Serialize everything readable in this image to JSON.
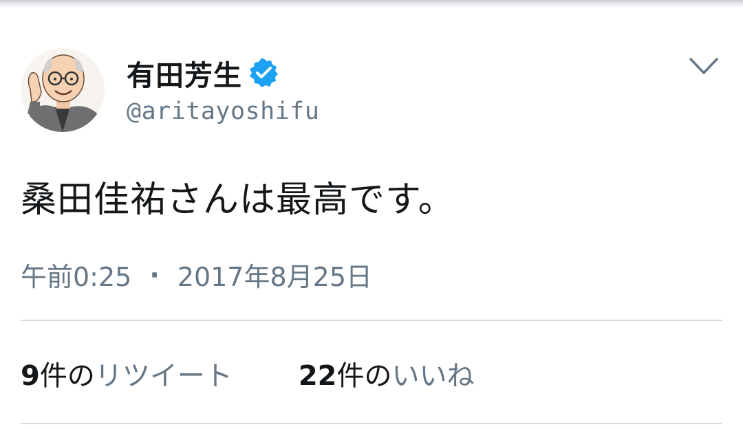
{
  "tweet": {
    "author": {
      "display_name": "有田芳生",
      "handle": "@aritayoshifu",
      "verified": true,
      "verified_color": "#1da1f2"
    },
    "text": "桑田佳祐さんは最高です。",
    "time": "午前0:25",
    "separator": "·",
    "date": "2017年8月25日",
    "stats": {
      "retweets": {
        "count": "9",
        "unit": "件の",
        "label": "リツイート"
      },
      "likes": {
        "count": "22",
        "unit": "件の",
        "label": "いいね"
      }
    },
    "menu_icon": "chevron-down-icon"
  },
  "colors": {
    "text_primary": "#14171a",
    "text_secondary": "#657786",
    "divider": "#d5dbe0"
  }
}
